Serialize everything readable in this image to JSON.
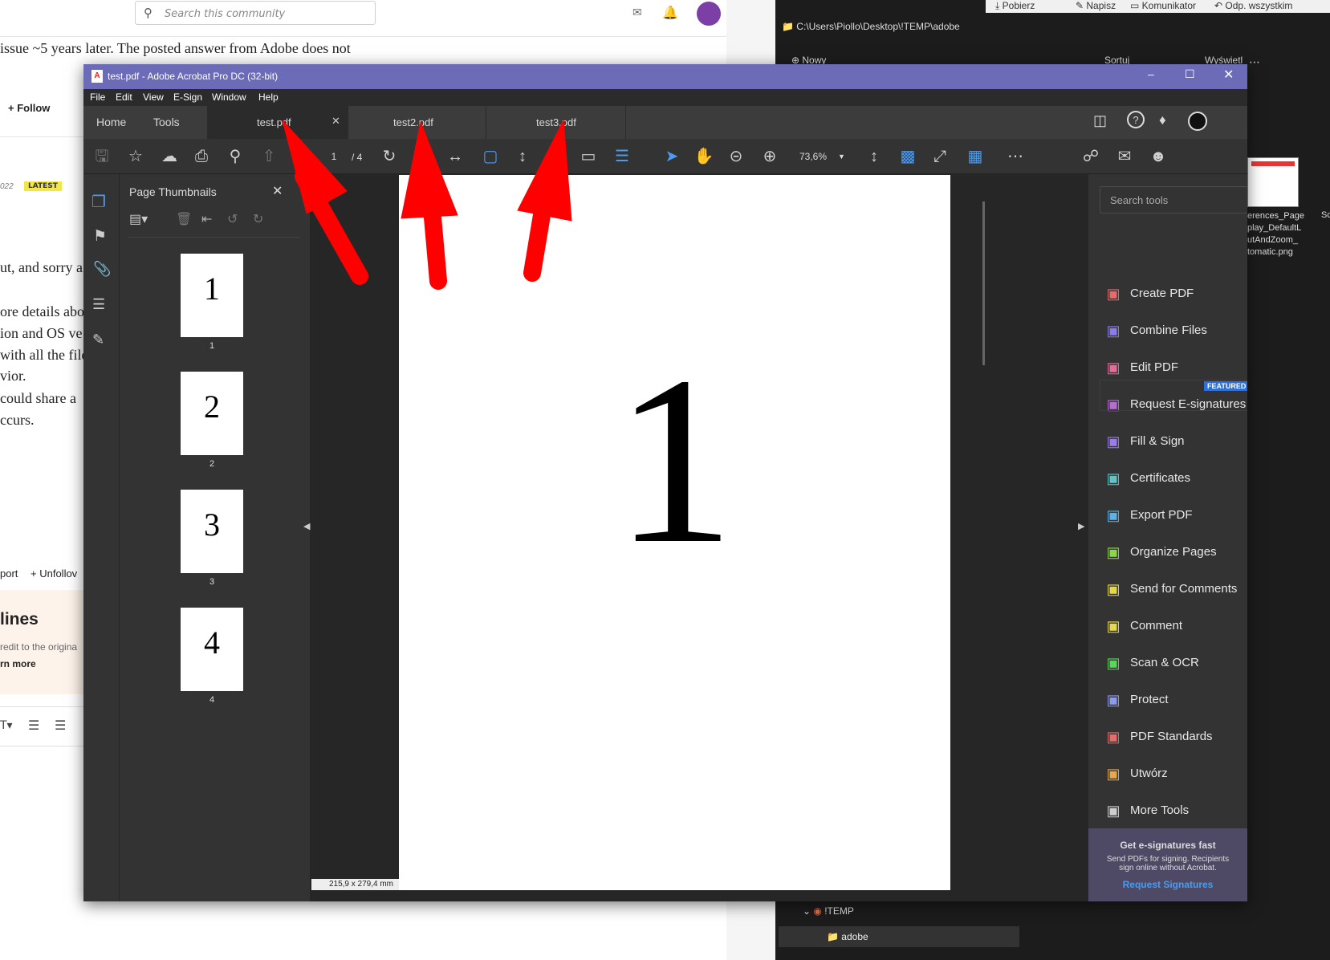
{
  "community": {
    "search_placeholder": "Search this community",
    "line1": "issue ~5 years later. The posted answer from Adobe does not",
    "follow": "Follow",
    "date_fragment": "022",
    "latest_badge": "LATEST",
    "reply_line1": "ut, and sorry a",
    "reply_line2": "ore details abo",
    "reply_line3": "ion and OS ve",
    "reply_line4": "with all the file",
    "reply_line5": "vior.",
    "reply_line6": "could share a",
    "reply_line7": "ccurs.",
    "report": "port",
    "unfollow": "Unfollov",
    "guidelines_title": "lines",
    "guidelines_text": "redit to the origina",
    "learn_more": "rn more"
  },
  "explorer": {
    "path": "C:\\Users\\Piollo\\Desktop\\!TEMP\\adobe",
    "top_items": [
      "Pobierz",
      "Napisz",
      "Komunikator",
      "Odp. wszystkim"
    ],
    "toolbar_items": [
      "Nowy",
      "Sortuj",
      "Wyświetl"
    ],
    "file_label_lines": [
      "erences_Page",
      "play_DefaultL",
      "utAndZoom_",
      "tomatic.png"
    ],
    "file_label_2": "Sc",
    "tree_items": [
      "!TEMP",
      "adobe"
    ]
  },
  "acrobat": {
    "title": "test.pdf - Adobe Acrobat Pro DC (32-bit)",
    "menu": [
      "File",
      "Edit",
      "View",
      "E-Sign",
      "Window",
      "Help"
    ],
    "nav": [
      "Home",
      "Tools"
    ],
    "tabs": [
      "test.pdf",
      "test2.pdf",
      "test3.pdf"
    ],
    "page_current": "1",
    "page_total": "/ 4",
    "zoom": "73,6%",
    "thumbnails_title": "Page Thumbnails",
    "thumbnails": [
      {
        "label": "1",
        "num": "1"
      },
      {
        "label": "2",
        "num": "2"
      },
      {
        "label": "3",
        "num": "3"
      },
      {
        "label": "4",
        "num": "4"
      }
    ],
    "page_content": "1",
    "page_size": "215,9 x 279,4 mm",
    "search_tools_placeholder": "Search tools",
    "tools": [
      {
        "label": "Create PDF",
        "icon": "create-pdf-icon",
        "color": "#e86a6a"
      },
      {
        "label": "Combine Files",
        "icon": "combine-files-icon",
        "color": "#8a7cf0"
      },
      {
        "label": "Edit PDF",
        "icon": "edit-pdf-icon",
        "color": "#e86a9a"
      },
      {
        "label": "Request E-signatures",
        "icon": "request-esign-icon",
        "color": "#b86ad8"
      },
      {
        "label": "Fill & Sign",
        "icon": "fill-sign-icon",
        "color": "#9a7cf0"
      },
      {
        "label": "Certificates",
        "icon": "certificates-icon",
        "color": "#5ac8c8"
      },
      {
        "label": "Export PDF",
        "icon": "export-pdf-icon",
        "color": "#5ab4e8"
      },
      {
        "label": "Organize Pages",
        "icon": "organize-pages-icon",
        "color": "#8ad848"
      },
      {
        "label": "Send for Comments",
        "icon": "send-comments-icon",
        "color": "#e8d848"
      },
      {
        "label": "Comment",
        "icon": "comment-icon",
        "color": "#e8d848"
      },
      {
        "label": "Scan & OCR",
        "icon": "scan-ocr-icon",
        "color": "#58d858"
      },
      {
        "label": "Protect",
        "icon": "protect-icon",
        "color": "#8a9cf0"
      },
      {
        "label": "PDF Standards",
        "icon": "pdf-standards-icon",
        "color": "#e86a6a"
      },
      {
        "label": "Utwórz",
        "icon": "utworz-icon",
        "color": "#e8a848"
      },
      {
        "label": "More Tools",
        "icon": "more-tools-icon",
        "color": "#cfcfcf"
      }
    ],
    "featured_badge": "FEATURED",
    "promo_title": "Get e-signatures fast",
    "promo_text_1": "Send PDFs for signing. Recipients",
    "promo_text_2": "sign online without Acrobat.",
    "promo_link": "Request Signatures"
  },
  "colors": {
    "title_bar": "#6b6bb8",
    "accent_blue": "#4a9cf0",
    "arrow_red": "#ff0000",
    "promo_bg": "#4e4a66"
  }
}
